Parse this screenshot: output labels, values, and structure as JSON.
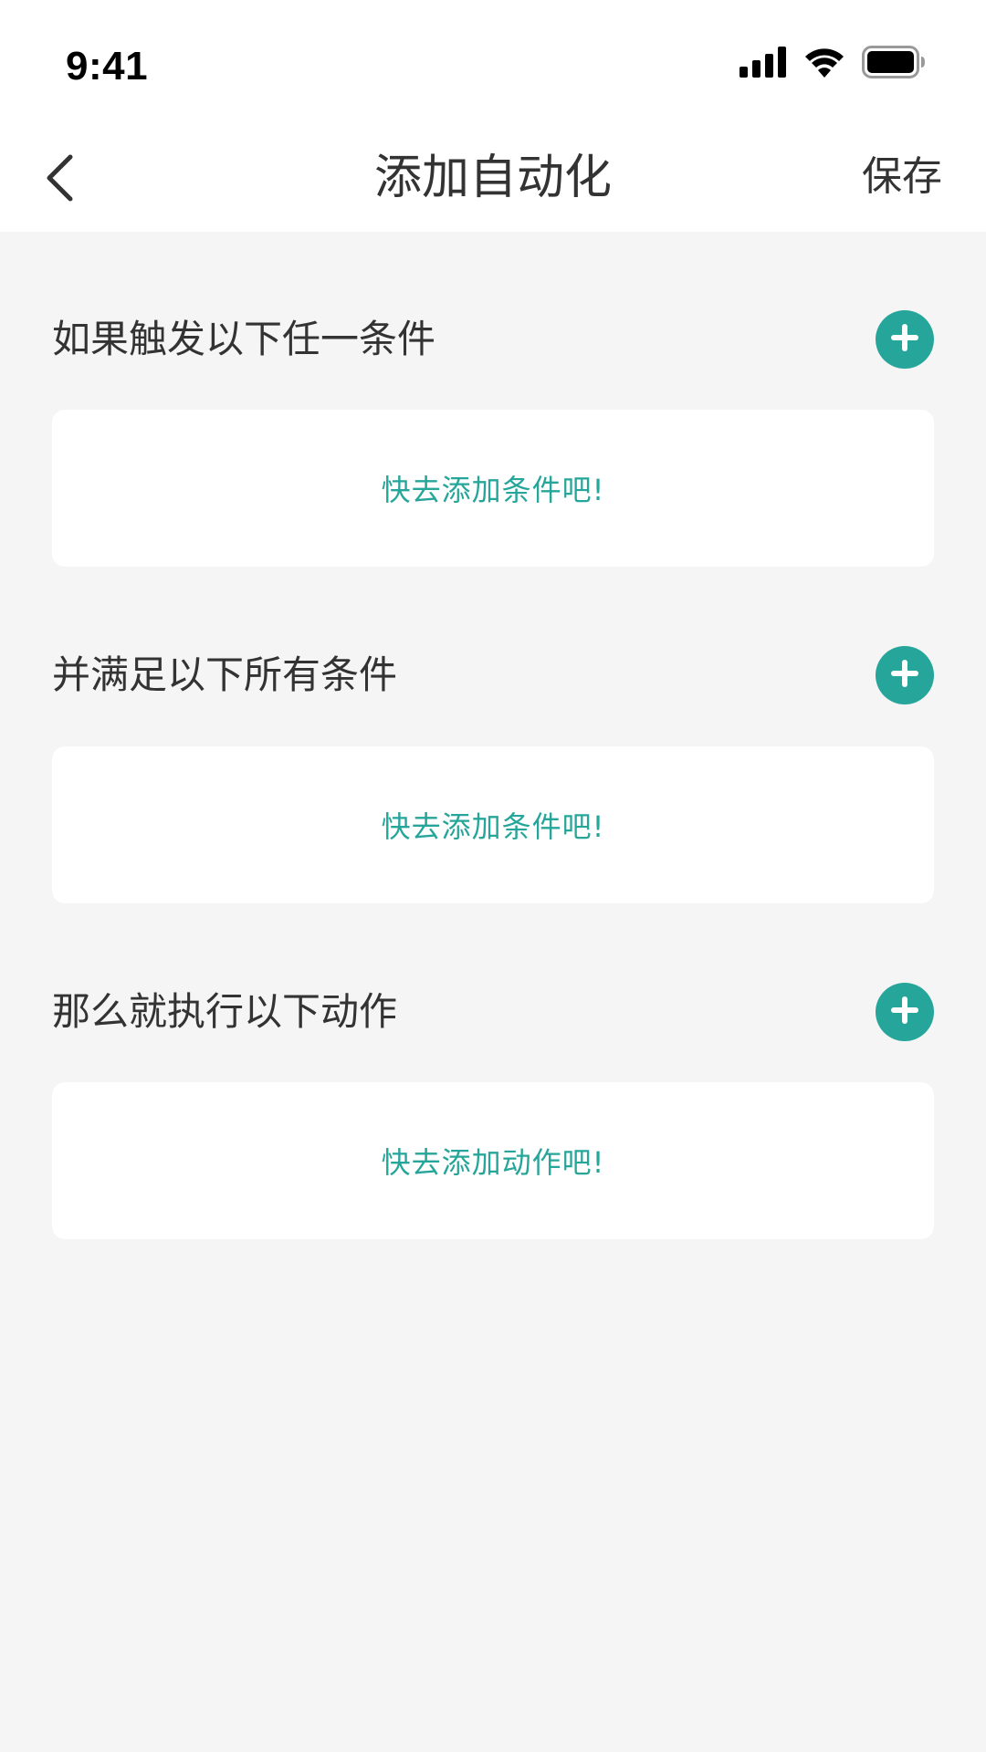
{
  "status_bar": {
    "time": "9:41",
    "icons": [
      "cellular-signal-icon",
      "wifi-icon",
      "battery-icon"
    ]
  },
  "nav": {
    "back_icon": "chevron-left-icon",
    "title": "添加自动化",
    "save_label": "保存"
  },
  "sections": [
    {
      "title": "如果触发以下任一条件",
      "add_icon": "plus-circle-icon",
      "empty_text": "快去添加条件吧!"
    },
    {
      "title": "并满足以下所有条件",
      "add_icon": "plus-circle-icon",
      "empty_text": "快去添加条件吧!"
    },
    {
      "title": "那么就执行以下动作",
      "add_icon": "plus-circle-icon",
      "empty_text": "快去添加动作吧!"
    }
  ],
  "colors": {
    "accent": "#26a69a",
    "background": "#f5f5f5",
    "surface": "#ffffff",
    "text": "#333333"
  }
}
